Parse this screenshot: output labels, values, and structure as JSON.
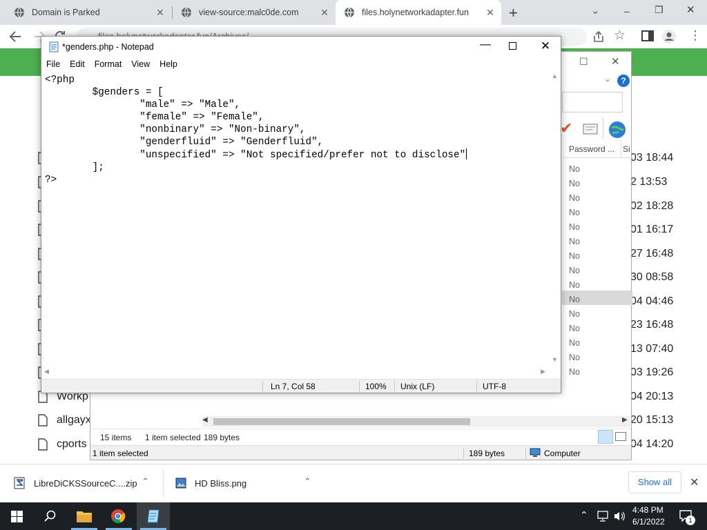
{
  "browser": {
    "tabs": [
      {
        "title": "Domain is Parked"
      },
      {
        "title": "view-source:malc0de.com"
      },
      {
        "title": "files.holynetworkadapter.fun"
      }
    ],
    "address": "files.holynetworkadapter.fun/Archives/",
    "new_tab": "+",
    "window_controls": {
      "min": "‒",
      "restore": "❐",
      "close": "✕"
    }
  },
  "page": {
    "dates": [
      "03 18:44",
      "2 13:53",
      "02 18:28",
      "01 16:17",
      "27 16:48",
      "30 08:58",
      "04 04:46",
      "23 16:48",
      "13 07:40",
      "03 19:26",
      "04 20:13",
      "20 15:13",
      "04 14:20"
    ],
    "names": [
      "Workp",
      "allgayx",
      "cports"
    ]
  },
  "explorer": {
    "column_password": "Password ...",
    "column_si": "Si",
    "no_values": [
      "No",
      "No",
      "No",
      "No",
      "No",
      "No",
      "No",
      "No",
      "No",
      "No",
      "No",
      "No",
      "No",
      "No",
      "No"
    ],
    "status_items": "15 items",
    "status_selected": "1 item selected",
    "status_size": "189 bytes",
    "bottom_selected": "1 item selected",
    "bottom_size": "189 bytes",
    "bottom_location": "Computer"
  },
  "notepad": {
    "title": "*genders.php - Notepad",
    "menu": [
      "File",
      "Edit",
      "Format",
      "View",
      "Help"
    ],
    "code_lines": [
      "<?php",
      "\t$genders = [",
      "\t\t\"male\" => \"Male\",",
      "\t\t\"female\" => \"Female\",",
      "\t\t\"nonbinary\" => \"Non-binary\",",
      "\t\t\"genderfluid\" => \"Genderfluid\",",
      "\t\t\"unspecified\" => \"Not specified/prefer not to disclose\"",
      "\t];",
      "?>"
    ],
    "status": {
      "position": "Ln 7, Col 58",
      "zoom": "100%",
      "line_ending": "Unix (LF)",
      "encoding": "UTF-8"
    }
  },
  "downloads": {
    "items": [
      {
        "name": "LibreDiCKSSourceC....zip"
      },
      {
        "name": "HD Bliss.png"
      }
    ],
    "show_all": "Show all"
  },
  "taskbar": {
    "time": "4:48 PM",
    "date": "6/1/2022",
    "notification_count": "1"
  }
}
